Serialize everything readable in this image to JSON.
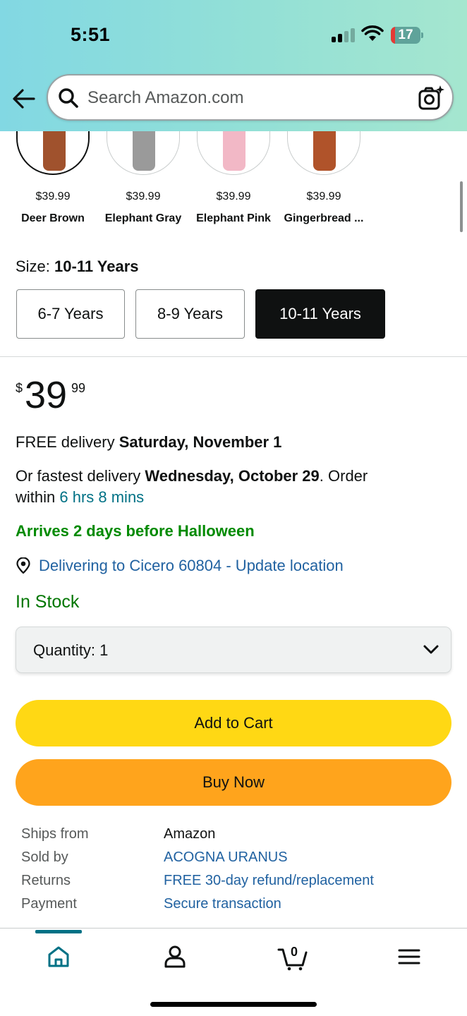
{
  "status_bar": {
    "time": "5:51",
    "battery": "17"
  },
  "search": {
    "placeholder": "Search Amazon.com"
  },
  "colors": {
    "accent_teal": "#007185",
    "add_to_cart": "#ffd814",
    "buy_now": "#ffa41c",
    "in_stock": "#007600",
    "link": "#2162a1"
  },
  "swatches": [
    {
      "price": "$39.99",
      "name": "Deer Brown",
      "selected": true
    },
    {
      "price": "$39.99",
      "name": "Elephant Gray",
      "selected": false
    },
    {
      "price": "$39.99",
      "name": "Elephant Pink",
      "selected": false
    },
    {
      "price": "$39.99",
      "name": "Gingerbread ...",
      "selected": false
    }
  ],
  "size": {
    "label": "Size: ",
    "selected": "10-11 Years",
    "options": [
      "6-7 Years",
      "8-9 Years",
      "10-11 Years"
    ]
  },
  "price": {
    "currency": "$",
    "whole": "39",
    "fraction": "99"
  },
  "delivery": {
    "free_prefix": "FREE delivery ",
    "free_date": "Saturday, November 1",
    "fast_prefix": "Or fastest delivery ",
    "fast_date": "Wednesday, October 29",
    "fast_order": ". Order",
    "within": "within ",
    "countdown": "6 hrs 8 mins",
    "arrives": "Arrives 2 days before Halloween",
    "location": "Delivering to Cicero 60804 - Update location"
  },
  "stock": "In Stock",
  "quantity": "Quantity: 1",
  "buttons": {
    "add_to_cart": "Add to Cart",
    "buy_now": "Buy Now"
  },
  "info": [
    {
      "label": "Ships from",
      "value": "Amazon",
      "is_link": false
    },
    {
      "label": "Sold by",
      "value": "ACOGNA URANUS",
      "is_link": true
    },
    {
      "label": "Returns",
      "value": "FREE 30-day refund/replacement",
      "is_link": true
    },
    {
      "label": "Payment",
      "value": "Secure transaction",
      "is_link": true
    }
  ],
  "bottom_nav": {
    "cart_count": "0",
    "icons": [
      "home-icon",
      "account-icon",
      "cart-icon",
      "menu-icon"
    ]
  }
}
